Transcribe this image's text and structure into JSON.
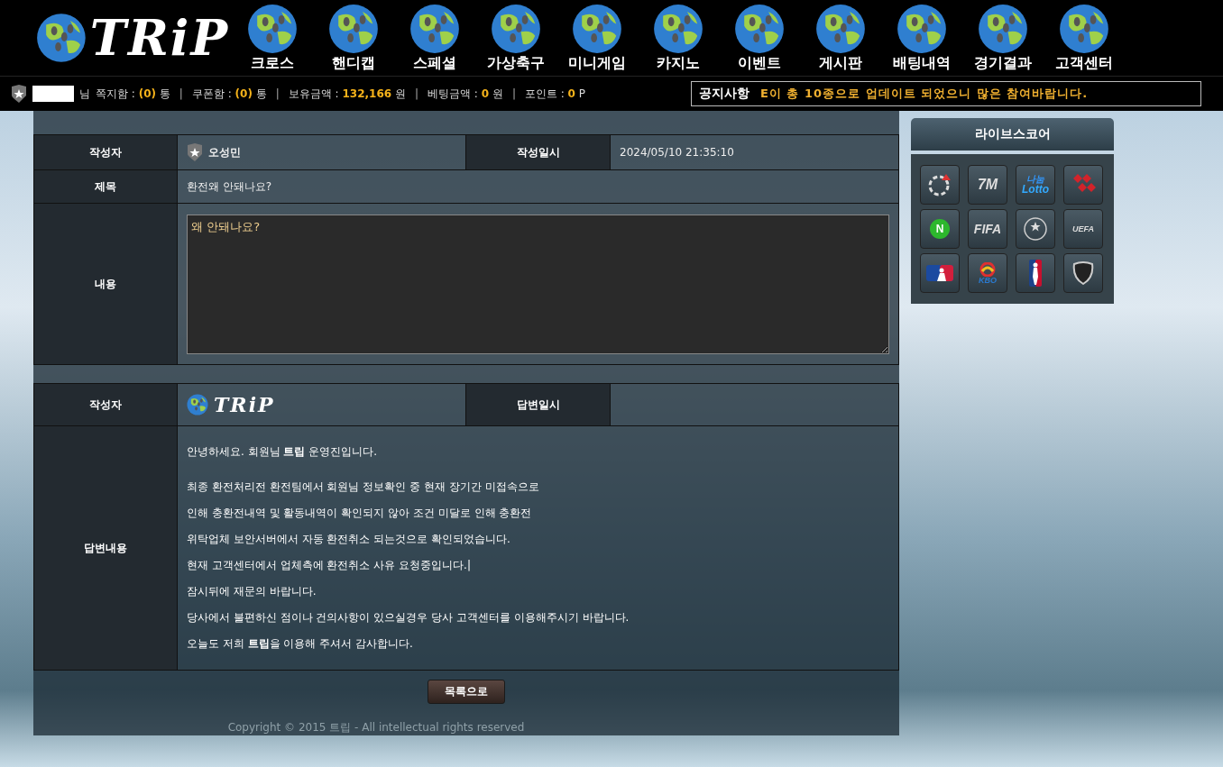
{
  "logo": {
    "text": "TRiP"
  },
  "nav": [
    {
      "label": "크로스"
    },
    {
      "label": "핸디캡"
    },
    {
      "label": "스페셜"
    },
    {
      "label": "가상축구"
    },
    {
      "label": "미니게임"
    },
    {
      "label": "카지노"
    },
    {
      "label": "이벤트"
    },
    {
      "label": "게시판"
    },
    {
      "label": "배팅내역"
    },
    {
      "label": "경기결과"
    },
    {
      "label": "고객센터"
    }
  ],
  "user_bar": {
    "suffix": "님",
    "separator": "|",
    "items": [
      {
        "label": "쪽지함 :",
        "value": "(0)",
        "unit": "통"
      },
      {
        "label": "쿠폰함 :",
        "value": "(0)",
        "unit": "통"
      },
      {
        "label": "보유금액 :",
        "value": "132,166",
        "unit": "원"
      },
      {
        "label": "베팅금액 :",
        "value": "0",
        "unit": "원"
      },
      {
        "label": "포인트 :",
        "value": "0",
        "unit": "P"
      }
    ]
  },
  "notice": {
    "title": "공지사항",
    "text": "E이 총 10종으로 업데이트 되었으니 많은 참여바랍니다."
  },
  "question": {
    "author_label": "작성자",
    "author": "오성민",
    "date_label": "작성일시",
    "date": "2024/05/10 21:35:10",
    "subject_label": "제목",
    "subject": "환전왜 안돼나요?",
    "content_label": "내용",
    "content": "왜 안돼나요?"
  },
  "answer": {
    "author_label": "작성자",
    "author_logo": "TRiP",
    "date_label": "답변일시",
    "content_label": "답변내용",
    "paragraphs": [
      "안녕하세요. 회원님 **트립** 운영진입니다.",
      "최종 환전처리전 환전팀에서 회원님 정보확인 중 현재 장기간 미접속으로",
      "인해 충환전내역 및 활동내역이 확인되지 않아 조건 미달로 인해 충환전",
      "위탁업체 보안서버에서 자동 환전취소 되는것으로 확인되었습니다.",
      "현재 고객센터에서 업체측에 환전취소 사유 요청중입니다.|",
      "잠시뒤에 재문의 바랍니다.",
      "당사에서 불편하신 점이나 건의사항이 있으실경우 당사 고객센터를 이용해주시기 바랍니다.",
      "오늘도 저희 **트립**을 이용해 주셔서 감사합니다."
    ]
  },
  "list_button": "목록으로",
  "footer": "Copyright © 2015 트립 - All intellectual rights reserved",
  "livescore": {
    "title": "라이브스코어",
    "tiles": [
      {
        "kind": "ring"
      },
      {
        "kind": "text",
        "label": "7M"
      },
      {
        "kind": "lotto",
        "sublabel": "나눔",
        "label": "Lotto"
      },
      {
        "kind": "diamonds"
      },
      {
        "kind": "badge",
        "label": "N"
      },
      {
        "kind": "text",
        "label": "FIFA"
      },
      {
        "kind": "stars"
      },
      {
        "kind": "arc",
        "label": "UEFA"
      },
      {
        "kind": "mlb"
      },
      {
        "kind": "kbo",
        "label": "KBO"
      },
      {
        "kind": "nba"
      },
      {
        "kind": "nhl"
      }
    ]
  }
}
